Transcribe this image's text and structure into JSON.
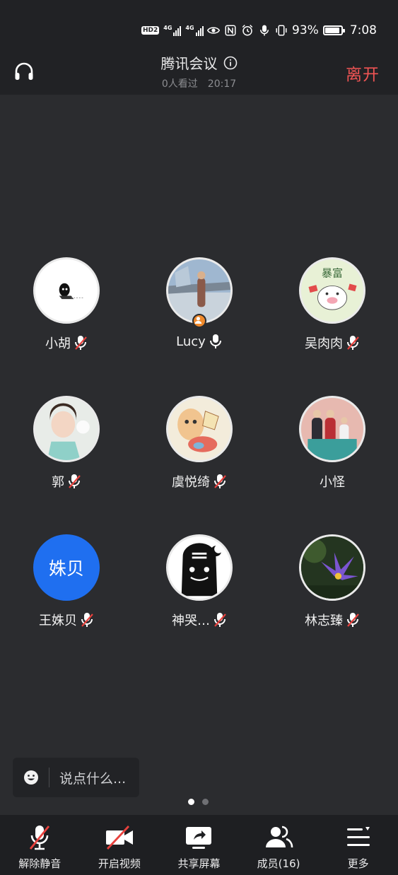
{
  "status_bar": {
    "hd": "HD",
    "sim": "2",
    "net1": "4G",
    "net2": "4G",
    "battery_percent": "93%",
    "battery_level": 0.93,
    "time": "7:08"
  },
  "header": {
    "title": "腾讯会议",
    "viewers": "0人看过",
    "duration": "20:17",
    "leave_label": "离开"
  },
  "participants": [
    {
      "name": "小胡",
      "mic": "muted",
      "avatar": "ninja-sticker"
    },
    {
      "name": "Lucy",
      "mic": "on",
      "avatar": "photo-person",
      "host": true
    },
    {
      "name": "吴肉肉",
      "mic": "muted",
      "avatar": "pig-cartoon",
      "avatar_text": "暴富"
    },
    {
      "name": "郭",
      "mic": "muted",
      "avatar": "photo-child"
    },
    {
      "name": "虞悦绮",
      "mic": "muted",
      "avatar": "drawing"
    },
    {
      "name": "小怪",
      "mic": "none",
      "avatar": "photo-family"
    },
    {
      "name": "王姝贝",
      "mic": "muted",
      "avatar": "text",
      "avatar_text": "姝贝"
    },
    {
      "name": "神哭…",
      "mic": "muted",
      "avatar": "black-cartoon"
    },
    {
      "name": "林志臻",
      "mic": "muted",
      "avatar": "photo-flower"
    }
  ],
  "chat": {
    "placeholder": "说点什么..."
  },
  "pager": {
    "pages": 2,
    "current": 1
  },
  "toolbar": {
    "unmute": "解除静音",
    "start_video": "开启视频",
    "share_screen": "共享屏幕",
    "members": "成员(16)",
    "more": "更多"
  },
  "colors": {
    "background": "#2b2c2f",
    "leave": "#f05454",
    "text_avatar": "#1f6ff0",
    "host_badge": "#f08a2c",
    "muted_slash": "#e8413d"
  }
}
